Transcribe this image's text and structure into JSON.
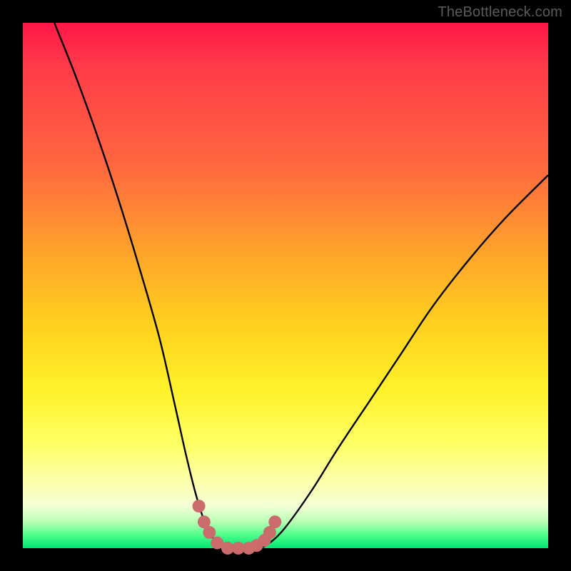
{
  "watermark": "TheBottleneck.com",
  "colors": {
    "frame": "#000000",
    "gradient_top": "#ff1648",
    "gradient_mid1": "#ff6a3f",
    "gradient_mid2": "#ffd21e",
    "gradient_mid3": "#feff63",
    "gradient_bottom": "#00e673",
    "curve_stroke": "#000000",
    "marker_fill": "#cc6b6c"
  },
  "chart_data": {
    "type": "line",
    "title": "",
    "xlabel": "",
    "ylabel": "",
    "xlim": [
      0,
      100
    ],
    "ylim": [
      0,
      100
    ],
    "grid": false,
    "legend": false,
    "note": "x = relative component balance (percent of axis); y = bottleneck severity (0 = none, 100 = max). Values estimated from pixel positions.",
    "series": [
      {
        "name": "bottleneck-curve",
        "x": [
          6,
          10,
          14,
          18,
          22,
          26,
          29,
          31,
          33,
          35,
          37,
          39,
          41,
          43,
          45,
          47,
          50,
          55,
          60,
          66,
          72,
          78,
          85,
          92,
          100
        ],
        "y": [
          100,
          90,
          79,
          67,
          54,
          40,
          27,
          18,
          10,
          4,
          1,
          0,
          0,
          0,
          0,
          1,
          4,
          11,
          19,
          28,
          37,
          46,
          55,
          63,
          71
        ]
      }
    ],
    "markers": {
      "name": "sweet-spot-markers",
      "note": "pink dot markers near the curve minimum",
      "x": [
        33.5,
        34.5,
        35.5,
        37,
        39,
        41,
        43,
        44.5,
        46,
        47,
        48
      ],
      "y": [
        8,
        5,
        3,
        1,
        0,
        0,
        0,
        0.5,
        1.5,
        3,
        5
      ]
    }
  }
}
